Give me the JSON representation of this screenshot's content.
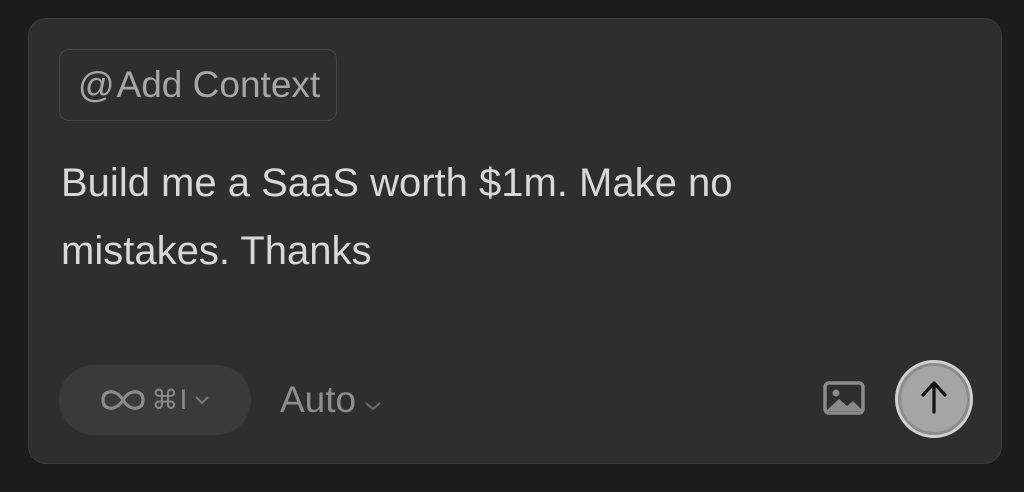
{
  "composer": {
    "context_button": {
      "at_symbol": "@",
      "label": "Add Context"
    },
    "prompt": "Build me a SaaS worth $1m. Make no\nmistakes. Thanks",
    "mode_selector": {
      "icon": "infinity-icon",
      "shortcut": "⌘I"
    },
    "model_selector": {
      "label": "Auto"
    },
    "image_button": {
      "icon": "image-icon"
    },
    "send_button": {
      "icon": "arrow-up-icon"
    }
  },
  "colors": {
    "background": "#1c1c1c",
    "panel": "#2e2e2e",
    "text": "#d8d8d8",
    "muted_text": "#8e8e8e",
    "send_button": "#a5a5a5"
  }
}
